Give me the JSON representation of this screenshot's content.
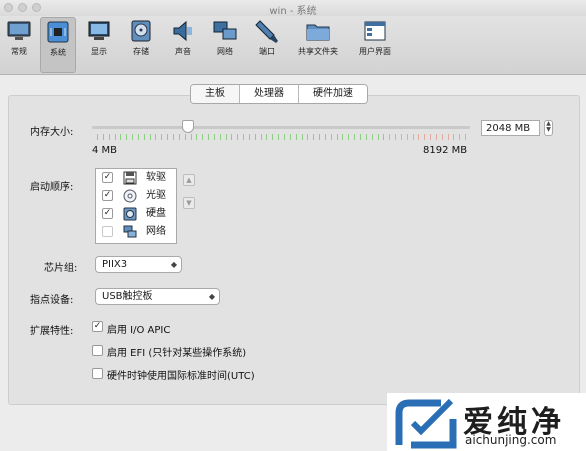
{
  "window": {
    "title": "win - 系统"
  },
  "toolbar": {
    "items": [
      {
        "label": "常规",
        "icon": "general-icon"
      },
      {
        "label": "系统",
        "icon": "system-icon",
        "selected": true
      },
      {
        "label": "显示",
        "icon": "display-icon"
      },
      {
        "label": "存储",
        "icon": "storage-icon"
      },
      {
        "label": "声音",
        "icon": "audio-icon"
      },
      {
        "label": "网络",
        "icon": "network-icon"
      },
      {
        "label": "端口",
        "icon": "ports-icon"
      },
      {
        "label": "共享文件夹",
        "icon": "shared-folder-icon"
      },
      {
        "label": "用户界面",
        "icon": "user-interface-icon"
      }
    ]
  },
  "tabs": [
    {
      "label": "主板",
      "selected": true
    },
    {
      "label": "处理器",
      "selected": false
    },
    {
      "label": "硬件加速",
      "selected": false
    }
  ],
  "memory": {
    "label": "内存大小:",
    "value": "2048 MB",
    "min_label": "4 MB",
    "max_label": "8192 MB",
    "slider_fraction": 0.25
  },
  "boot_order": {
    "label": "启动顺序:",
    "items": [
      {
        "label": "软驱",
        "checked": true,
        "icon": "floppy-icon"
      },
      {
        "label": "光驱",
        "checked": true,
        "icon": "optical-drive-icon"
      },
      {
        "label": "硬盘",
        "checked": true,
        "icon": "hard-disk-icon"
      },
      {
        "label": "网络",
        "checked": false,
        "icon": "network-boot-icon"
      }
    ]
  },
  "chipset": {
    "label": "芯片组:",
    "value": "PIIX3"
  },
  "pointing": {
    "label": "指点设备:",
    "value": "USB触控板"
  },
  "extended": {
    "label": "扩展特性:",
    "options": [
      {
        "label": "启用 I/O APIC",
        "checked": true
      },
      {
        "label": "启用 EFI (只针对某些操作系统)",
        "checked": false
      },
      {
        "label": "硬件时钟使用国际标准时间(UTC)",
        "checked": false
      }
    ]
  },
  "watermark": {
    "text": "爱纯净",
    "url": "aichunjing.com"
  },
  "colors": {
    "slider_green": "#8fce85",
    "slider_red": "#e3a9a0",
    "accent": "#4a8fd6"
  }
}
